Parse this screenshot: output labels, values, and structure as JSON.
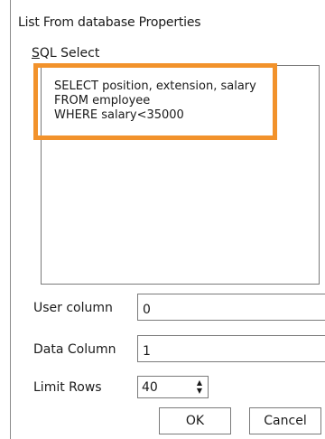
{
  "window": {
    "title": "List From database Properties"
  },
  "sql": {
    "label_prefix": "S",
    "label_rest": "QL Select",
    "query_lines": [
      "SELECT position, extension, salary",
      "FROM employee",
      "WHERE salary<35000"
    ]
  },
  "fields": {
    "user_column": {
      "label": "User column",
      "value": "0"
    },
    "data_column": {
      "label": "Data Column",
      "value": "1"
    },
    "limit_rows": {
      "label": "Limit Rows",
      "value": "40"
    }
  },
  "buttons": {
    "ok": "OK",
    "cancel": "Cancel"
  },
  "colors": {
    "highlight": "#f2922b",
    "border": "#7a7a7a"
  },
  "icons": {
    "spinner_up": "▲",
    "spinner_down": "▼"
  }
}
